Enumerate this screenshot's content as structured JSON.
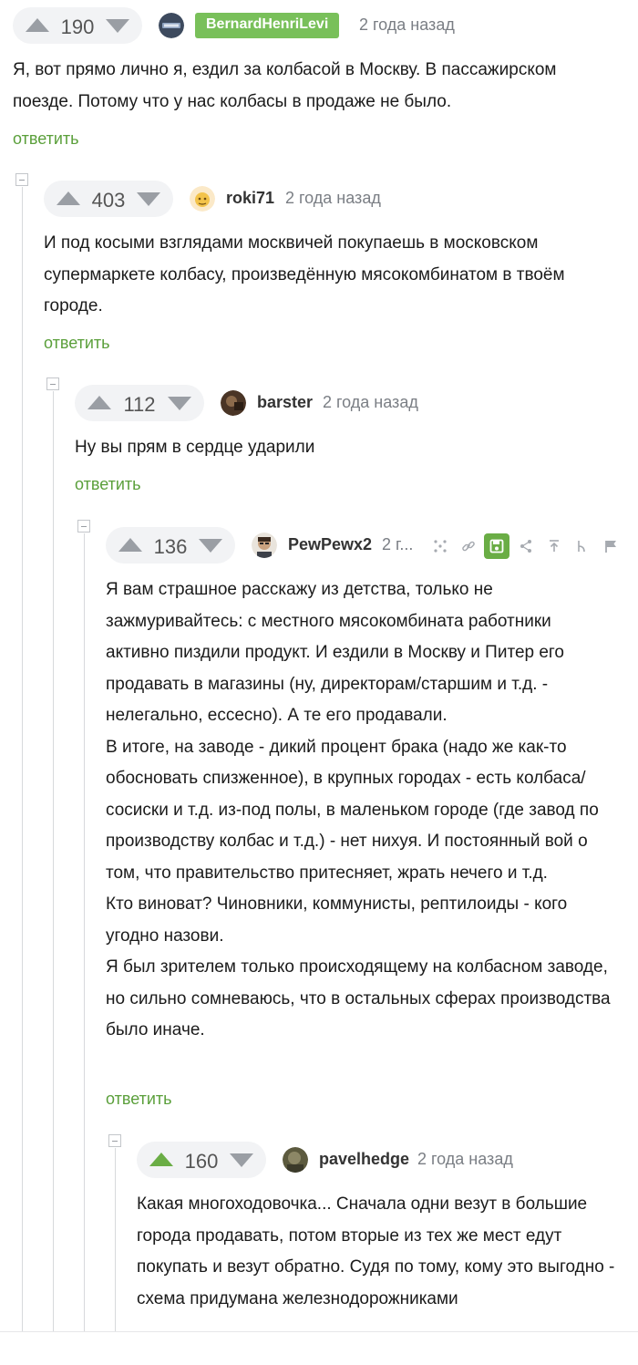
{
  "comments": [
    {
      "votes": "190",
      "author": "BernardHenriLevi",
      "time": "2 года назад",
      "paragraphs": [
        "Я, вот прямо лично я, ездил за колбасой в Москву. В пассажирском поезде. Потому что у нас колбасы в продаже не было."
      ],
      "reply_label": "ответить"
    },
    {
      "votes": "403",
      "author": "roki71",
      "time": "2 года назад",
      "paragraphs": [
        "И под косыми взглядами москвичей покупаешь в московском супермаркете колбасу, произведённую мясокомбинатом в твоём городе."
      ],
      "reply_label": "ответить"
    },
    {
      "votes": "112",
      "author": "barster",
      "time": "2 года назад",
      "paragraphs": [
        "Ну вы прям в сердце ударили"
      ],
      "reply_label": "ответить"
    },
    {
      "votes": "136",
      "author": "PewPewx2",
      "time": "2 г...",
      "paragraphs": [
        "Я вам страшное расскажу из детства, только не зажмуривайтесь: с местного мясокомбината работники активно пиздили продукт. И ездили в Москву и Питер его продавать в магазины (ну, директорам/старшим и т.д. - нелегально, ессесно). А те его продавали.",
        "В итоге, на заводе - дикий процент брака (надо же как-то обосновать спизженное), в крупных городах - есть колбаса/сосиски и т.д. из-под полы, в маленьком городе (где завод по производству колбас и т.д.) - нет нихуя. И постоянный вой о том, что правительство притесняет, жрать нечего и т.д.",
        "Кто виноват? Чиновники, коммунисты, рептилоиды - кого угодно назови.",
        "Я был зрителем только происходящему на колбасном заводе, но сильно сомневаюсь, что в остальных сферах производства было иначе."
      ],
      "reply_label": "ответить"
    },
    {
      "votes": "160",
      "author": "pavelhedge",
      "time": "2 года назад",
      "paragraphs": [
        "Какая многоходовочка... Сначала одни везут в большие города продавать, потом вторые из тех же мест едут покупать и везут обратно. Судя по тому, кому это выгодно - схема придумана железнодорожниками"
      ]
    }
  ],
  "colors": {
    "accent": "#6aad45",
    "badge": "#79c05a",
    "vote_bg": "#f2f3f5",
    "muted": "#7a7e84"
  },
  "icons": [
    "arrow-up-icon",
    "arrow-down-icon",
    "avatar",
    "sub-comments-icon",
    "link-icon",
    "save-icon",
    "share-icon",
    "scroll-top-icon",
    "branch-icon",
    "flag-icon",
    "collapse-icon"
  ]
}
